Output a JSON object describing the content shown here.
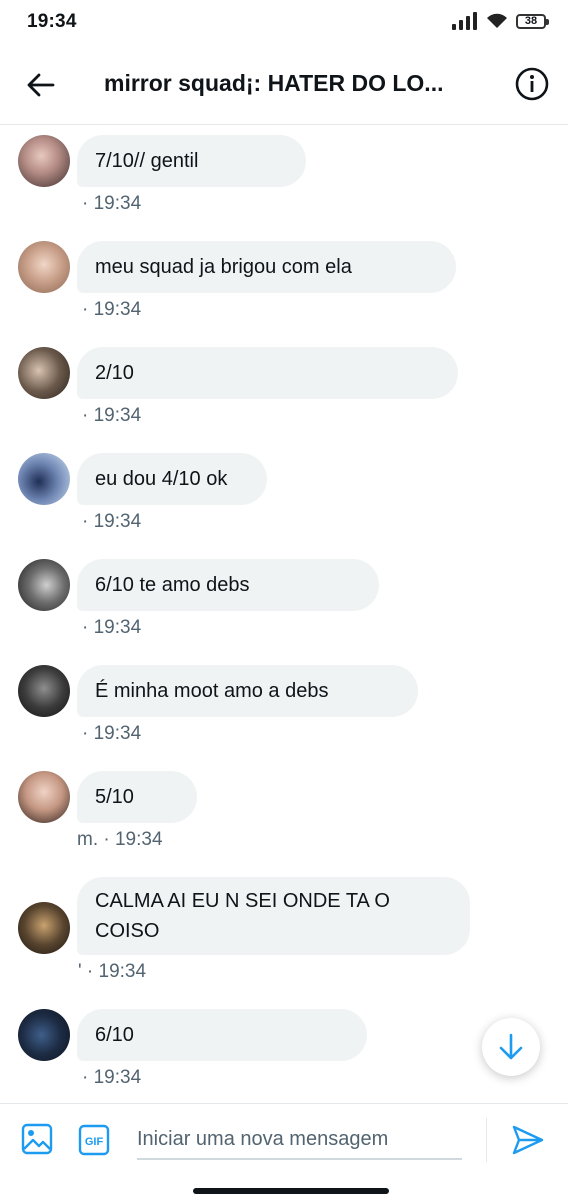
{
  "status_bar": {
    "time": "19:34",
    "battery": "38"
  },
  "header": {
    "title": "mirror squad¡: HATER DO LO..."
  },
  "messages": [
    {
      "text": "7/10// gentil",
      "meta": "· 19:34"
    },
    {
      "text": "meu squad ja brigou com ela",
      "meta": "· 19:34"
    },
    {
      "text": "2/10",
      "meta": "· 19:34"
    },
    {
      "text": "eu dou 4/10 ok",
      "meta": "· 19:34"
    },
    {
      "text": "6/10 te amo debs",
      "meta": "· 19:34"
    },
    {
      "text": "É minha moot amo a debs",
      "meta": "· 19:34"
    },
    {
      "text": "5/10",
      "meta": "m. · 19:34"
    },
    {
      "text": "CALMA AI EU N SEI ONDE TA O COISO",
      "meta": "' · 19:34"
    },
    {
      "text": "6/10",
      "meta": "· 19:34"
    }
  ],
  "composer": {
    "placeholder": "Iniciar uma nova mensagem",
    "gif_label": "GIF"
  },
  "colors": {
    "accent": "#1d9bf0",
    "bubble": "#eff3f4",
    "meta": "#536471"
  }
}
